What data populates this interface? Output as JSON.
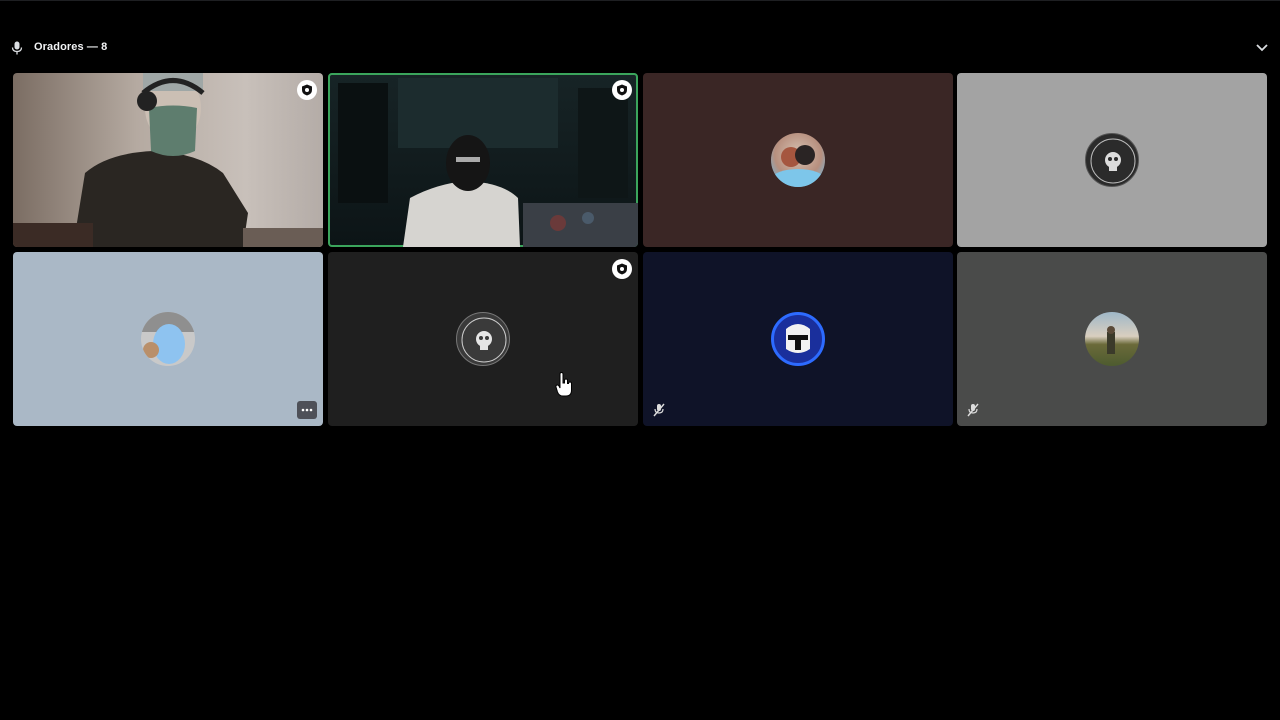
{
  "header": {
    "title": "Oradores — 8"
  },
  "tiles": [
    {
      "id": "tile-1",
      "type": "video",
      "bg": "#9c8f84",
      "badge": "shield-icon",
      "speaking": false
    },
    {
      "id": "tile-2",
      "type": "video",
      "bg": "#0f1a1c",
      "badge": "shield-icon",
      "speaking": true
    },
    {
      "id": "tile-3",
      "type": "avatar",
      "bg": "#3a2625",
      "avatar": "couple-photo-avatar"
    },
    {
      "id": "tile-4",
      "type": "avatar",
      "bg": "#a3a3a3",
      "avatar": "clan-azteca-badge-avatar"
    },
    {
      "id": "tile-5",
      "type": "avatar",
      "bg": "#aab8c6",
      "avatar": "blue-figure-avatar",
      "more": true
    },
    {
      "id": "tile-6",
      "type": "avatar",
      "bg": "#1f1f1f",
      "avatar": "clan-azteca-badge-avatar",
      "badge": "shield-icon"
    },
    {
      "id": "tile-7",
      "type": "avatar",
      "bg": "#0f1328",
      "avatar": "clone-trooper-avatar",
      "muted": true
    },
    {
      "id": "tile-8",
      "type": "avatar",
      "bg": "#4a4b4a",
      "avatar": "landscape-avatar",
      "muted": true
    }
  ],
  "colors": {
    "speaking_ring": "#3ba55c",
    "background": "#000000"
  }
}
